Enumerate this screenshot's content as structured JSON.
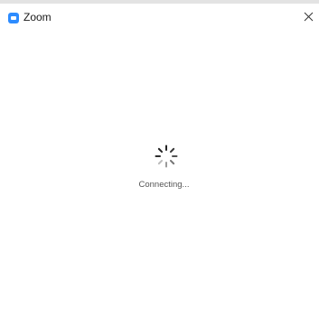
{
  "window": {
    "title": "Zoom",
    "app_icon": "zoom-camera-icon",
    "accent_color": "#2d8cff"
  },
  "titlebar": {
    "close_icon": "close-icon"
  },
  "main": {
    "spinner_icon": "loading-spinner-icon",
    "status_text": "Connecting..."
  }
}
